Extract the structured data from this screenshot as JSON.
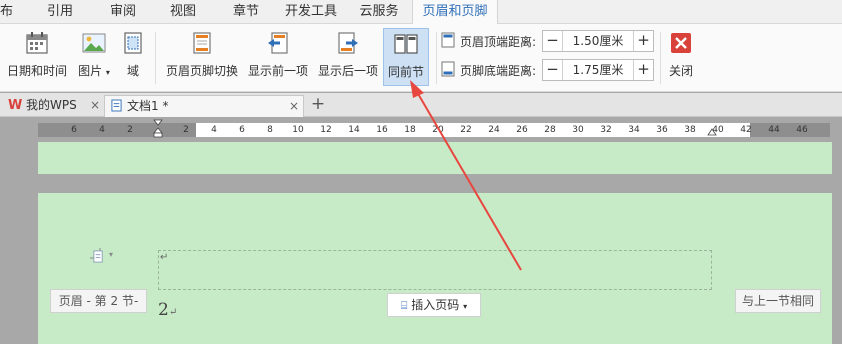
{
  "menu": {
    "tabs": [
      "布局",
      "引用",
      "审阅",
      "视图",
      "章节",
      "开发工具",
      "云服务",
      "页眉和页脚"
    ],
    "active_tab": "页眉和页脚"
  },
  "ribbon": {
    "date_time": "日期和时间",
    "picture": "图片",
    "field": "域",
    "switch_header_footer": "页眉页脚切换",
    "show_previous": "显示前一项",
    "show_next": "显示后一项",
    "same_as_previous": "同前节",
    "header_top_label": "页眉顶端距离:",
    "header_top_value": "1.50厘米",
    "footer_bottom_label": "页脚底端距离:",
    "footer_bottom_value": "1.75厘米",
    "close": "关闭"
  },
  "doc_tabs": {
    "home": "我的WPS",
    "doc": "文档1 *",
    "add": "+"
  },
  "ruler": {
    "labels": [
      "6",
      "4",
      "2",
      "2",
      "4",
      "6",
      "8",
      "10",
      "12",
      "14",
      "16",
      "18",
      "20",
      "22",
      "24",
      "26",
      "28",
      "30",
      "32",
      "34",
      "36",
      "38",
      "40",
      "42",
      "44",
      "46"
    ]
  },
  "document": {
    "header_tag": "页眉  - 第 2 节-",
    "insert_page_number": "插入页码",
    "same_as_previous_badge": "与上一节相同",
    "page_number": "2",
    "para_mark": "↵"
  },
  "colors": {
    "page_bg": "#c7ebc7",
    "accent": "#2f6fb8",
    "arrow": "#e8473f"
  }
}
